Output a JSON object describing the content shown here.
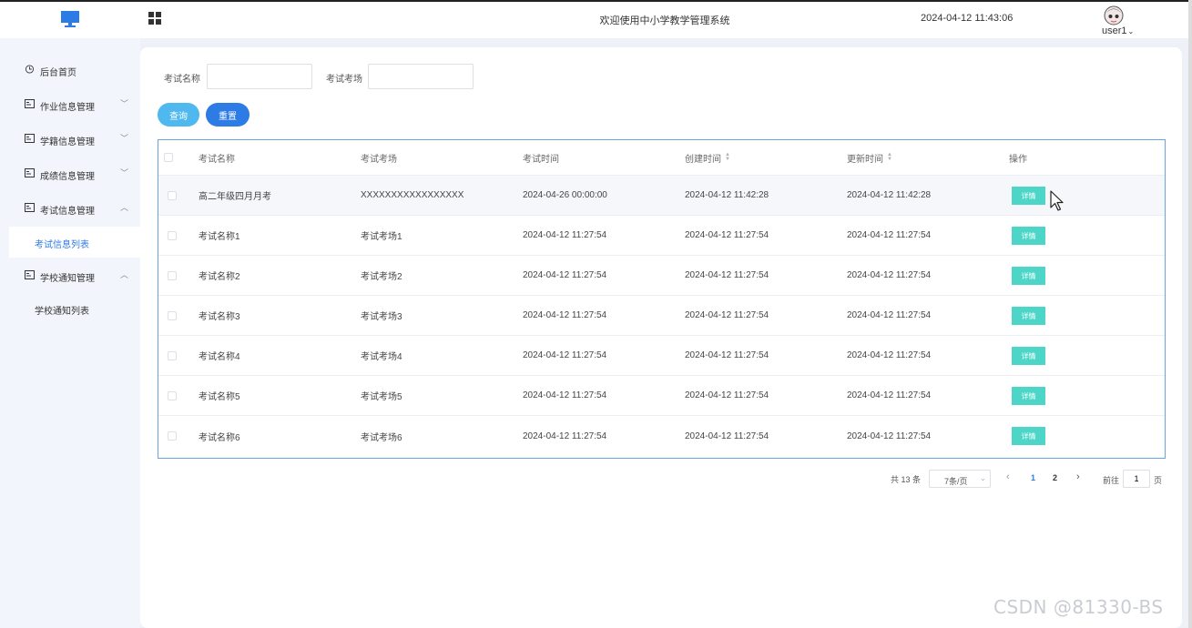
{
  "header": {
    "welcome": "欢迎使用中小学教学管理系统",
    "datetime": "2024-04-12 11:43:06",
    "username": "user1",
    "logo_icon": "monitor-icon",
    "menu_toggle_icon": "grid-icon"
  },
  "sidebar": {
    "items": [
      {
        "label": "后台首页",
        "icon": "clock-icon"
      },
      {
        "label": "作业信息管理",
        "icon": "card-icon",
        "chevron": "﹀"
      },
      {
        "label": "学籍信息管理",
        "icon": "card-icon",
        "chevron": "﹀"
      },
      {
        "label": "成绩信息管理",
        "icon": "card-icon",
        "chevron": "﹀"
      },
      {
        "label": "考试信息管理",
        "icon": "card-icon",
        "chevron": "︿"
      },
      {
        "label": "学校通知管理",
        "icon": "card-icon",
        "chevron": "︿"
      }
    ],
    "sub_items": {
      "exam_list": "考试信息列表",
      "notice_list": "学校通知列表"
    }
  },
  "search": {
    "exam_name_label": "考试名称",
    "exam_name_value": "",
    "exam_room_label": "考试考场",
    "exam_room_value": "",
    "query_label": "查询",
    "reset_label": "重置"
  },
  "table": {
    "columns": [
      "考试名称",
      "考试考场",
      "考试时间",
      "创建时间",
      "更新时间",
      "操作"
    ],
    "rows": [
      [
        "高二年级四月月考",
        "XXXXXXXXXXXXXXXXX",
        "2024-04-26 00:00:00",
        "2024-04-12 11:42:28",
        "2024-04-12 11:42:28",
        "详情"
      ],
      [
        "考试名称1",
        "考试考场1",
        "2024-04-12 11:27:54",
        "2024-04-12 11:27:54",
        "2024-04-12 11:27:54",
        "详情"
      ],
      [
        "考试名称2",
        "考试考场2",
        "2024-04-12 11:27:54",
        "2024-04-12 11:27:54",
        "2024-04-12 11:27:54",
        "详情"
      ],
      [
        "考试名称3",
        "考试考场3",
        "2024-04-12 11:27:54",
        "2024-04-12 11:27:54",
        "2024-04-12 11:27:54",
        "详情"
      ],
      [
        "考试名称4",
        "考试考场4",
        "2024-04-12 11:27:54",
        "2024-04-12 11:27:54",
        "2024-04-12 11:27:54",
        "详情"
      ],
      [
        "考试名称5",
        "考试考场5",
        "2024-04-12 11:27:54",
        "2024-04-12 11:27:54",
        "2024-04-12 11:27:54",
        "详情"
      ],
      [
        "考试名称6",
        "考试考场6",
        "2024-04-12 11:27:54",
        "2024-04-12 11:27:54",
        "2024-04-12 11:27:54",
        "详情"
      ]
    ]
  },
  "pagination": {
    "total": "共 13 条",
    "page_size": "7条/页",
    "pages": [
      "1",
      "2"
    ],
    "current_page": "1",
    "goto_label": "前往",
    "goto_value": "1",
    "page_suffix": "页",
    "prev_icon": "‹",
    "next_icon": "›"
  },
  "watermark": "CSDN @81330-BS",
  "colors": {
    "primary": "#2d7be5",
    "query": "#4fb8ef",
    "detail": "#4dd6c8",
    "sidebar_bg": "#f2f5fb"
  }
}
